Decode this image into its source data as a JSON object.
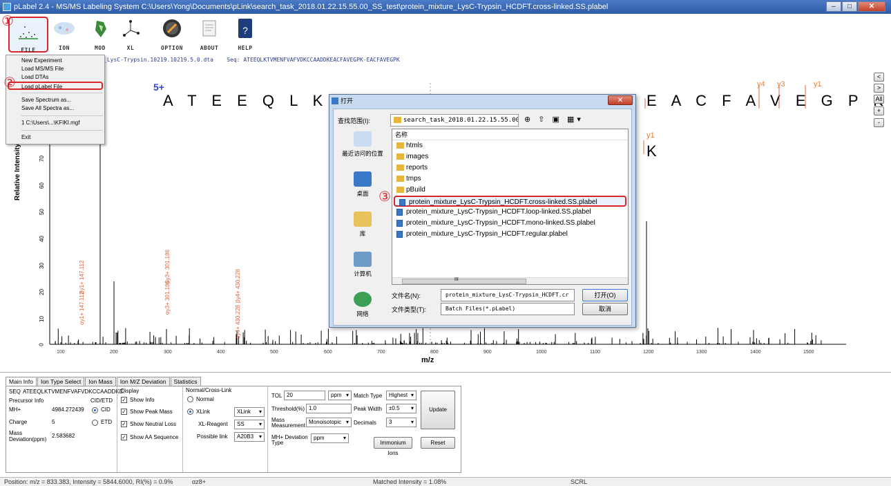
{
  "window": {
    "title": "pLabel 2.4 - MS/MS Labeling System C:\\Users\\Yong\\Documents\\pLink\\search_task_2018.01.22.15.55.00_SS_test\\protein_mixture_LysC-Trypsin_HCDFT.cross-linked.SS.plabel",
    "min": "–",
    "max": "□",
    "close": "✕"
  },
  "toolbar": {
    "items": [
      {
        "label": "FILE",
        "icon": "file-icon"
      },
      {
        "label": "ION",
        "icon": "ion-icon"
      },
      {
        "label": "MOD",
        "icon": "mod-icon"
      },
      {
        "label": "XL",
        "icon": "xl-icon"
      },
      {
        "label": "OPTION",
        "icon": "option-icon"
      },
      {
        "label": "ABOUT",
        "icon": "about-icon"
      },
      {
        "label": "HELP",
        "icon": "help-icon"
      }
    ]
  },
  "annotations": {
    "one": "①",
    "two": "②",
    "three": "③"
  },
  "info_line": {
    "file": "_LysC-Trypsin.10219.10219.5.0.dta",
    "seq_label": "Seq:",
    "seq": "ATEEQLKTVMENFVAFVDKCCAADDKEACFAVEGPK-EACFAVEGPK"
  },
  "spectrum": {
    "charge": "5+",
    "peptide_left": "A T E E Q L K T V",
    "peptide_right": "E A C F A V E G P K",
    "peptide2_end": "K",
    "ion_labels": [
      "y4",
      "y3",
      "y1"
    ],
    "ion_label_mid": "y1",
    "ylabel": "Relative   Intensity (%)",
    "xlabel": "m/z",
    "yticks": [
      "70",
      "60",
      "50",
      "40",
      "30",
      "20",
      "10",
      "0"
    ],
    "xticks": [
      "100",
      "200",
      "300",
      "400",
      "500",
      "600",
      "700",
      "800",
      "900",
      "1000",
      "1100",
      "1200",
      "1300",
      "1400",
      "1500"
    ],
    "fragments": [
      "αy1+ 147.112",
      "βy1+ 147.112",
      "αy3+ 301.186",
      "βy3+ 301.186",
      "αy4+ 430.228",
      "βy4+ 430.228"
    ]
  },
  "right_buttons": [
    "<",
    ">",
    "All",
    "+",
    "-"
  ],
  "file_menu": {
    "items": [
      "New Experiment",
      "Load MS/MS File",
      "Load DTAs",
      "Load pLabel File",
      "Save Spectrum as...",
      "Save All Spectra as...",
      "1 C:\\Users\\...\\KFIKI.mgf",
      "Exit"
    ],
    "highlight_index": 3
  },
  "dialog": {
    "title": "打开",
    "close": "✕",
    "lookin_label": "查找范围(I):",
    "lookin_value": "search_task_2018.01.22.15.55.00_SS_t",
    "nav_icons": "⊕ ⇧ ▣ ▦▾",
    "places": [
      "最近访问的位置",
      "桌面",
      "库",
      "计算机",
      "网络"
    ],
    "list_header": "名称",
    "folders": [
      "htmls",
      "images",
      "reports",
      "tmps",
      "pBuild"
    ],
    "files": [
      "protein_mixture_LysC-Trypsin_HCDFT.cross-linked.SS.plabel",
      "protein_mixture_LysC-Trypsin_HCDFT.loop-linked.SS.plabel",
      "protein_mixture_LysC-Trypsin_HCDFT.mono-linked.SS.plabel",
      "protein_mixture_LysC-Trypsin_HCDFT.regular.plabel"
    ],
    "scroll_mark": "III",
    "filename_label": "文件名(N):",
    "filename_value": "protein_mixture_LysC-Trypsin_HCDFT.cr",
    "filetype_label": "文件类型(T):",
    "filetype_value": "Batch Files(*.pLabel)",
    "open": "打开(O)",
    "cancel": "取消"
  },
  "tabs": [
    "Main Info",
    "Ion Type Select",
    "Ion Mass",
    "Ion M/Z Deviation",
    "Statistics"
  ],
  "main_info": {
    "seq_label": "SEQ",
    "seq_value": "ATEEQLKTVMENFVAFVDKCCAADDKE.",
    "precursor_info": "Precursor Info",
    "mh_label": "MH+",
    "mh_value": "4984.272439",
    "charge_label": "Charge",
    "charge_value": "5",
    "mass_dev_label": "Mass\nDeviation(ppm)",
    "mass_dev_value": "2.583682",
    "cidetd_label": "CID/ETD",
    "cid": "CID",
    "etd": "ETD",
    "display_label": "Display",
    "show_info": "Show Info",
    "show_peak_mass": "Show Peak Mass",
    "show_neutral_loss": "Show Neutral Loss",
    "show_aa_sequence": "Show AA Sequence",
    "normal_cross_label": "Normal/Cross-Link",
    "normal": "Normal",
    "xlink": "XLink",
    "xlink_select": "XLink",
    "xl_reagent_label": "XL-Reagent",
    "xl_reagent_value": "SS",
    "possible_link_label": "Possible link",
    "possible_link_value": "A20B3",
    "tol_label": "TOL",
    "tol_value": "20",
    "tol_unit": "ppm",
    "threshold_label": "Threshold(%)",
    "threshold_value": "1.0",
    "mass_meas_label": "Mass\nMeasurement",
    "mass_meas_value": "Monoisotopic",
    "mh_dev_label": "MH+ Deviation\nType",
    "mh_dev_value": "ppm",
    "match_type_label": "Match Type",
    "match_type_value": "Highest",
    "peak_width_label": "Peak Width",
    "peak_width_value": "±0.5",
    "decimals_label": "Decimals",
    "decimals_value": "3",
    "update": "Update",
    "immonium": "Immonium Ions",
    "reset": "Reset"
  },
  "status": {
    "position": "Position: m/z = 833.383, Intensity = 5844.6000, RI(%) = 0.9%",
    "charge": "αz8+",
    "matched": "Matched Intensity = 1.08%",
    "scrl": "SCRL"
  },
  "colors": {
    "accent_red": "#d9252a",
    "peptide_orange": "#f07c30",
    "fragment": "#e2633b",
    "charge_blue": "#2c46d6"
  }
}
